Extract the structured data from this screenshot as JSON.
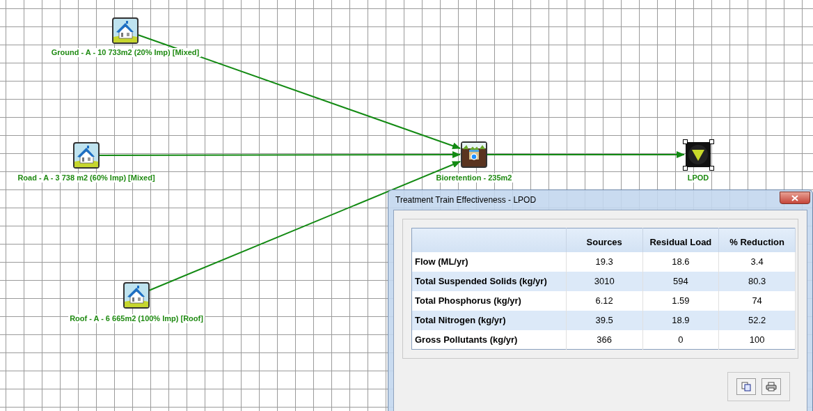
{
  "canvas": {
    "nodes": [
      {
        "kind": "house",
        "label": "Ground - A - 10 733m2 (20% Imp) [Mixed]",
        "selected": false
      },
      {
        "kind": "house",
        "label": "Road - A - 3 738 m2 (60% Imp) [Mixed]",
        "selected": false
      },
      {
        "kind": "house",
        "label": "Roof - A - 6 665m2 (100% Imp) [Roof]",
        "selected": false
      },
      {
        "kind": "bioretention",
        "label": "Bioretention - 235m2",
        "selected": false
      },
      {
        "kind": "outlet",
        "label": "LPOD",
        "selected": true
      }
    ]
  },
  "dialog": {
    "title": "Treatment Train Effectiveness - LPOD",
    "table": {
      "columns": [
        "Sources",
        "Residual Load",
        "% Reduction"
      ],
      "rows": [
        {
          "label": "Flow (ML/yr)",
          "cells": [
            "19.3",
            "18.6",
            "3.4"
          ]
        },
        {
          "label": "Total Suspended Solids (kg/yr)",
          "cells": [
            "3010",
            "594",
            "80.3"
          ]
        },
        {
          "label": "Total Phosphorus (kg/yr)",
          "cells": [
            "6.12",
            "1.59",
            "74"
          ]
        },
        {
          "label": "Total Nitrogen (kg/yr)",
          "cells": [
            "39.5",
            "18.9",
            "52.2"
          ]
        },
        {
          "label": "Gross Pollutants (kg/yr)",
          "cells": [
            "366",
            "0",
            "100"
          ]
        }
      ]
    }
  }
}
